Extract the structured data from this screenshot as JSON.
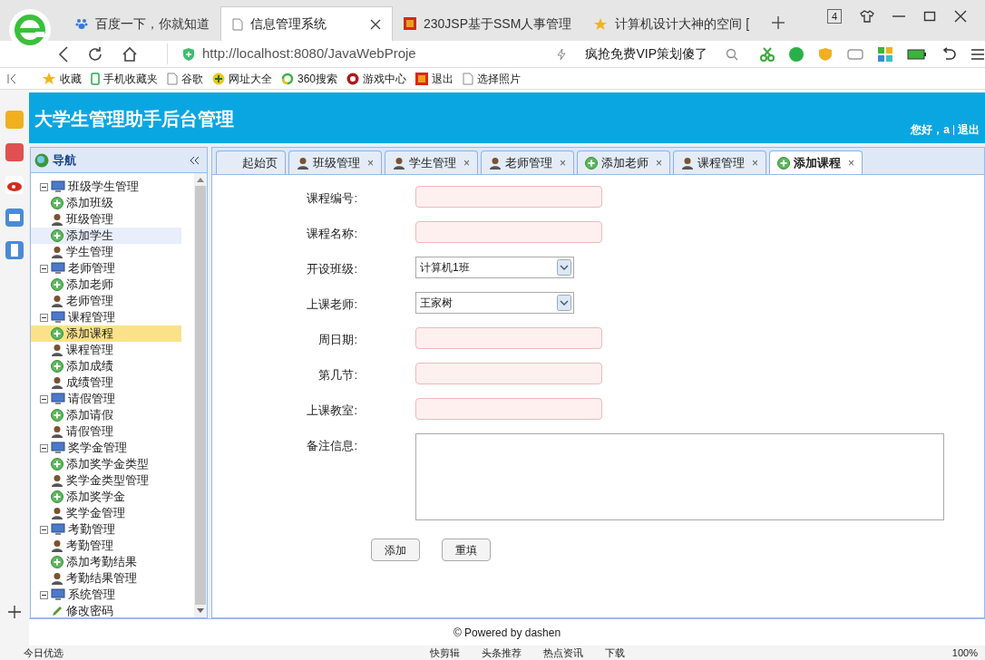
{
  "browser": {
    "tabs": [
      {
        "title": "百度一下，你就知道",
        "selected": false
      },
      {
        "title": "信息管理系统",
        "selected": true
      },
      {
        "title": "230JSP基于SSM人事管理",
        "selected": false
      },
      {
        "title": "计算机设计大神的空间 [",
        "selected": false
      }
    ],
    "tab_count": "4",
    "url": "http://localhost:8080/JavaWebProje",
    "search": "疯抢免费VIP策划傻了",
    "bookmarks": [
      "收藏",
      "手机收藏夹",
      "谷歌",
      "网址大全",
      "360搜索",
      "游戏中心",
      "退出",
      "选择照片"
    ],
    "status_bar": [
      "今日优选",
      "快剪辑",
      "头条推荐",
      "热点资讯",
      "下载",
      "100%"
    ]
  },
  "app": {
    "title": "大学生管理助手后台管理",
    "greeting": "您好，a",
    "logout": "退出",
    "nav": {
      "title": "导航",
      "tree": [
        {
          "label": "班级学生管理",
          "children": [
            {
              "label": "添加班级",
              "kind": "add",
              "selected": false,
              "hovered": false
            },
            {
              "label": "班级管理",
              "kind": "person",
              "selected": false,
              "hovered": false
            },
            {
              "label": "添加学生",
              "kind": "add",
              "selected": false,
              "hovered": true
            },
            {
              "label": "学生管理",
              "kind": "person",
              "selected": false,
              "hovered": false
            }
          ]
        },
        {
          "label": "老师管理",
          "children": [
            {
              "label": "添加老师",
              "kind": "add",
              "selected": false,
              "hovered": false
            },
            {
              "label": "老师管理",
              "kind": "person",
              "selected": false,
              "hovered": false
            }
          ]
        },
        {
          "label": "课程管理",
          "children": [
            {
              "label": "添加课程",
              "kind": "add",
              "selected": true,
              "hovered": false
            },
            {
              "label": "课程管理",
              "kind": "person",
              "selected": false,
              "hovered": false
            },
            {
              "label": "添加成绩",
              "kind": "add",
              "selected": false,
              "hovered": false
            },
            {
              "label": "成绩管理",
              "kind": "person",
              "selected": false,
              "hovered": false
            }
          ]
        },
        {
          "label": "请假管理",
          "children": [
            {
              "label": "添加请假",
              "kind": "add",
              "selected": false,
              "hovered": false
            },
            {
              "label": "请假管理",
              "kind": "person",
              "selected": false,
              "hovered": false
            }
          ]
        },
        {
          "label": "奖学金管理",
          "children": [
            {
              "label": "添加奖学金类型",
              "kind": "add",
              "selected": false,
              "hovered": false
            },
            {
              "label": "奖学金类型管理",
              "kind": "person",
              "selected": false,
              "hovered": false
            },
            {
              "label": "添加奖学金",
              "kind": "add",
              "selected": false,
              "hovered": false
            },
            {
              "label": "奖学金管理",
              "kind": "person",
              "selected": false,
              "hovered": false
            }
          ]
        },
        {
          "label": "考勤管理",
          "children": [
            {
              "label": "考勤管理",
              "kind": "person",
              "selected": false,
              "hovered": false
            },
            {
              "label": "添加考勤结果",
              "kind": "add",
              "selected": false,
              "hovered": false
            },
            {
              "label": "考勤结果管理",
              "kind": "person",
              "selected": false,
              "hovered": false
            }
          ]
        },
        {
          "label": "系统管理",
          "children": [
            {
              "label": "修改密码",
              "kind": "edit",
              "selected": false,
              "hovered": false
            }
          ]
        }
      ]
    },
    "tabs": [
      {
        "label": "起始页",
        "kind": "none",
        "selected": false
      },
      {
        "label": "班级管理",
        "kind": "person",
        "close": "×",
        "selected": false
      },
      {
        "label": "学生管理",
        "kind": "person",
        "close": "×",
        "selected": false
      },
      {
        "label": "老师管理",
        "kind": "person",
        "close": "×",
        "selected": false
      },
      {
        "label": "添加老师",
        "kind": "add",
        "close": "×",
        "selected": false
      },
      {
        "label": "课程管理",
        "kind": "person",
        "close": "×",
        "selected": false
      },
      {
        "label": "添加课程",
        "kind": "add",
        "close": "×",
        "selected": true
      }
    ],
    "form": [
      {
        "label": "课程编号:",
        "kind": "text"
      },
      {
        "label": "课程名称:",
        "kind": "text"
      },
      {
        "label": "开设班级:",
        "kind": "select",
        "value": "计算机1班"
      },
      {
        "label": "上课老师:",
        "kind": "select",
        "value": "王家树"
      },
      {
        "label": "周日期:",
        "kind": "text"
      },
      {
        "label": "第几节:",
        "kind": "text"
      },
      {
        "label": "上课教室:",
        "kind": "text"
      },
      {
        "label": "备注信息:",
        "kind": "textarea"
      }
    ],
    "buttons": [
      "添加",
      "重填"
    ],
    "footer": "© Powered by dashen"
  }
}
